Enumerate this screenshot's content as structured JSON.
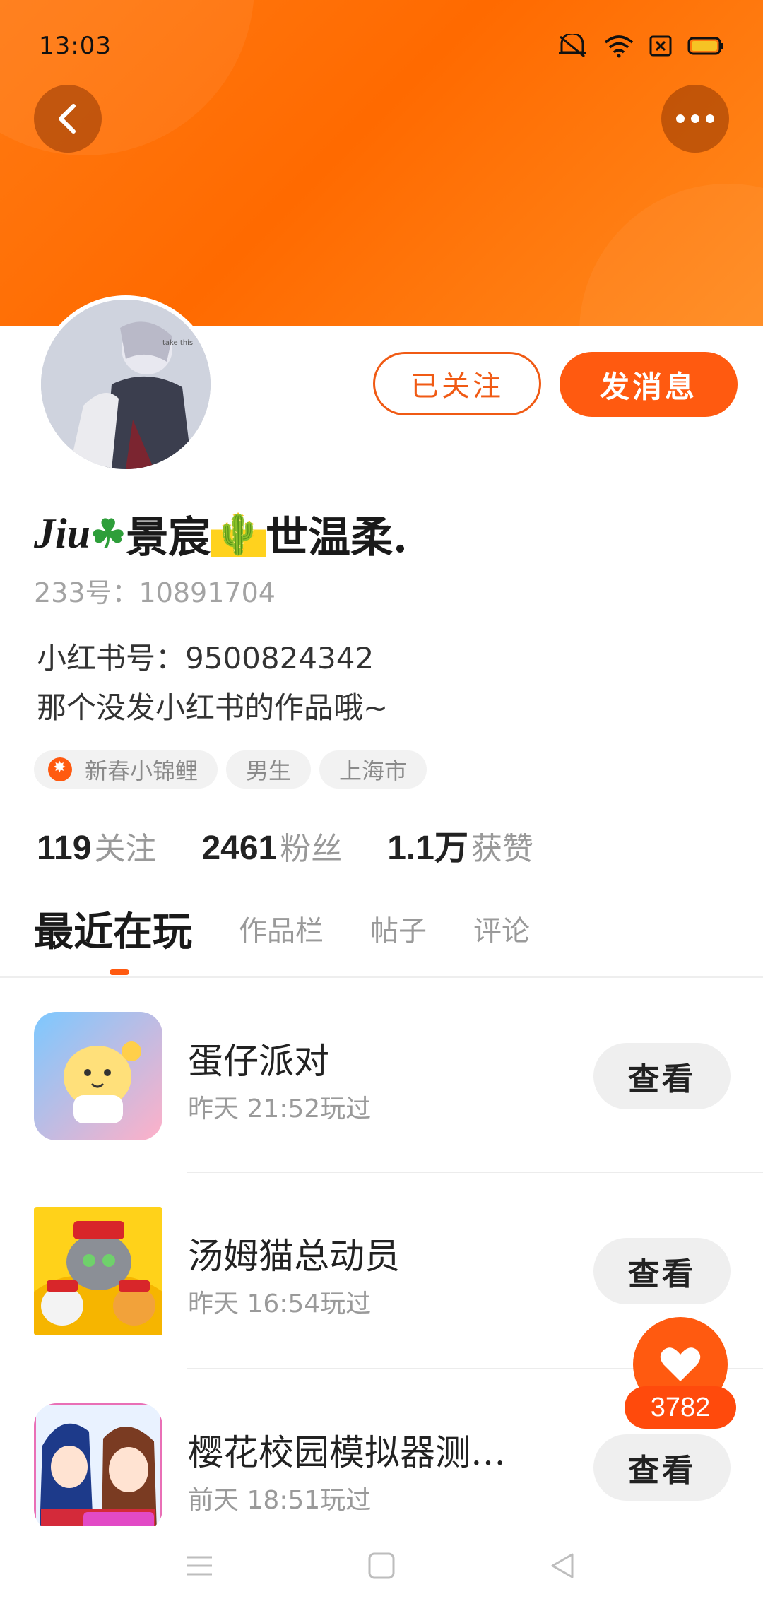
{
  "status_bar": {
    "time": "13:03",
    "icons": [
      "mute-icon",
      "wifi-icon",
      "sim-icon",
      "battery-icon"
    ]
  },
  "header": {
    "back_icon": "chevron-left-icon",
    "more_icon": "more-icon"
  },
  "actions": {
    "follow_label": "已关注",
    "message_label": "发消息"
  },
  "profile": {
    "name_prefix": "Jiu",
    "name_mid": "景宸",
    "name_end": "世温柔.",
    "id_line": "233号：10891704",
    "xhs_line": "小红书号：9500824342",
    "bio": "那个没发小红书的作品哦~"
  },
  "tags": [
    {
      "label": "新春小锦鲤",
      "has_badge": true
    },
    {
      "label": "男生"
    },
    {
      "label": "上海市"
    }
  ],
  "stats": [
    {
      "value": "119",
      "label": "关注"
    },
    {
      "value": "2461",
      "label": "粉丝"
    },
    {
      "value": "1.1万",
      "label": "获赞"
    }
  ],
  "tabs": [
    {
      "label": "最近在玩",
      "active": true
    },
    {
      "label": "作品栏"
    },
    {
      "label": "帖子"
    },
    {
      "label": "评论"
    }
  ],
  "games": [
    {
      "title": "蛋仔派对",
      "played": "昨天 21:52玩过",
      "view_label": "查看"
    },
    {
      "title": "汤姆猫总动员",
      "played": "昨天 16:54玩过",
      "view_label": "查看"
    },
    {
      "title": "樱花校园模拟器测…",
      "played": "前天 18:51玩过",
      "view_label": "查看"
    }
  ],
  "like": {
    "count": "3782"
  },
  "colors": {
    "accent": "#ff5a10",
    "header": "#ff7a12"
  }
}
